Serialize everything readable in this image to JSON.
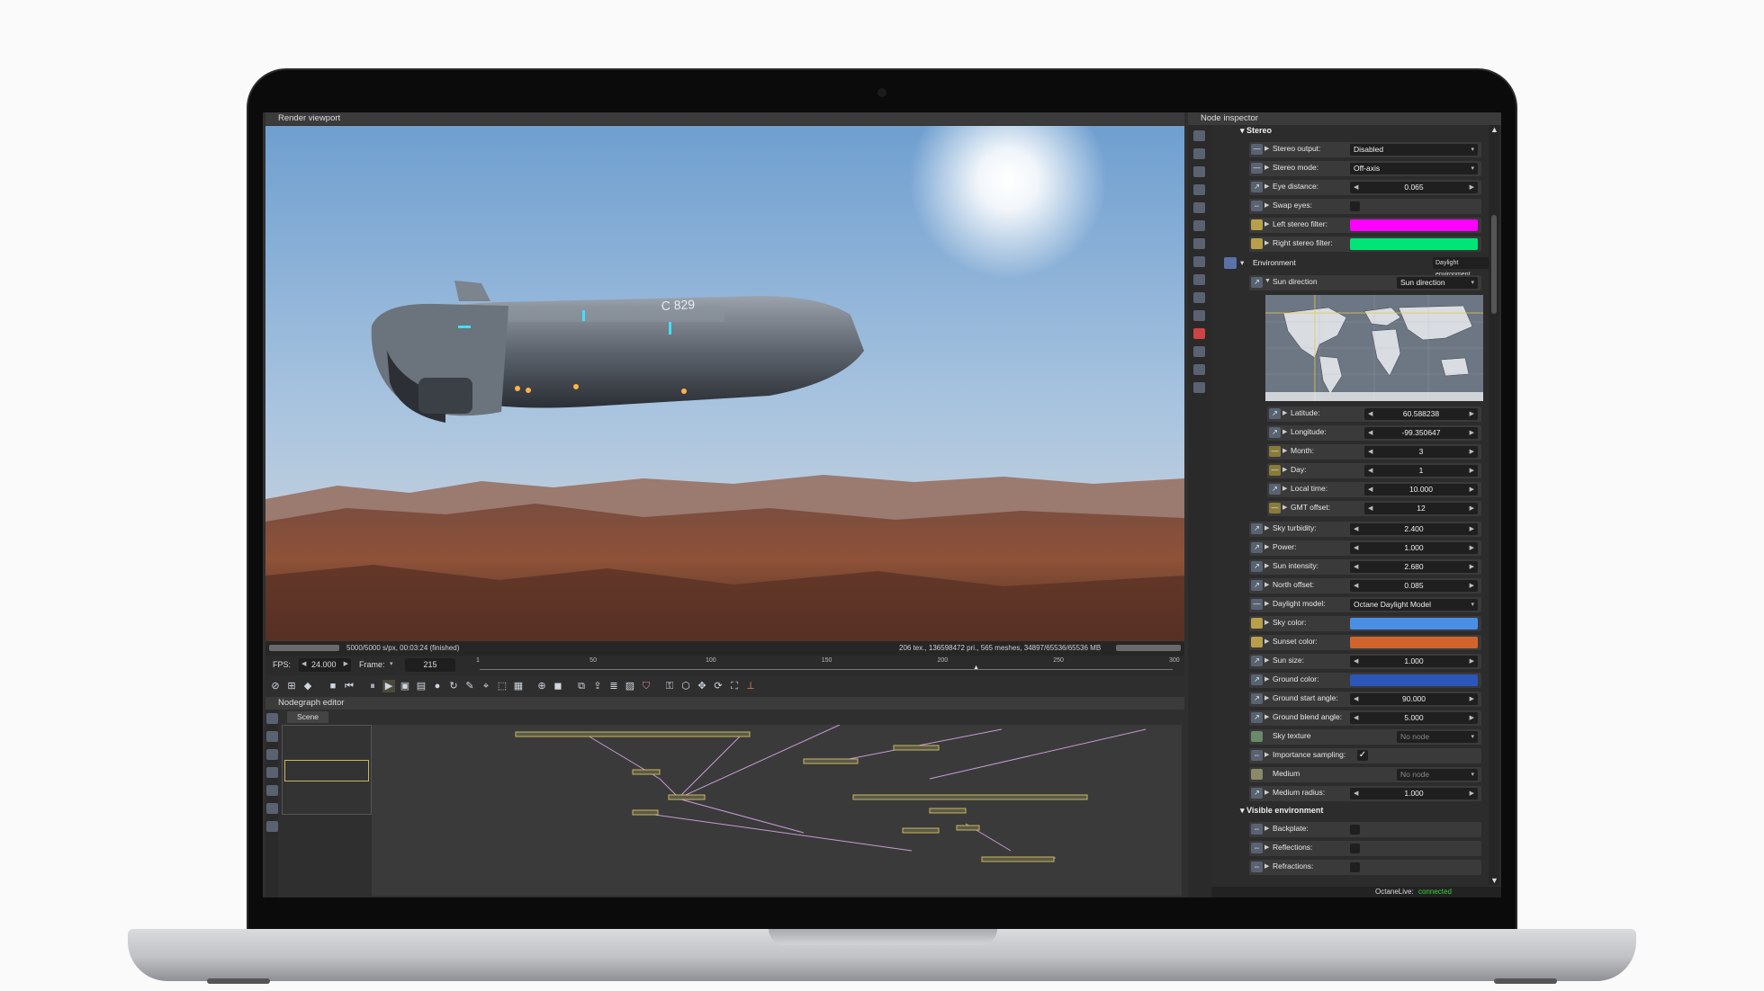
{
  "viewport": {
    "title": "Render viewport",
    "status_left": "5000/5000 s/px, 00:03:24 (finished)",
    "status_right": "206 tex., 136598472 pri., 565 meshes, 34897/65536/65536 MB"
  },
  "timeline": {
    "fps_label": "FPS:",
    "fps_value": "24.000",
    "frame_label": "Frame:",
    "frame_value": "215",
    "ticks": [
      "1",
      "50",
      "100",
      "150",
      "200",
      "250",
      "300"
    ],
    "playhead_frame": 215
  },
  "nodegraph": {
    "title": "Nodegraph editor",
    "tab": "Scene"
  },
  "inspector": {
    "title": "Node inspector",
    "stereo": {
      "header": "Stereo",
      "stereo_output": {
        "label": "Stereo output:",
        "value": "Disabled"
      },
      "stereo_mode": {
        "label": "Stereo mode:",
        "value": "Off-axis"
      },
      "eye_distance": {
        "label": "Eye distance:",
        "value": "0.065"
      },
      "swap_eyes": {
        "label": "Swap eyes:"
      },
      "left_filter": {
        "label": "Left stereo filter:",
        "color": "#ff00ff"
      },
      "right_filter": {
        "label": "Right stereo filter:",
        "color": "#00e676"
      }
    },
    "environment": {
      "header": "Environment",
      "type": "Daylight environment",
      "sun_direction": {
        "label": "Sun direction",
        "value": "Sun direction"
      },
      "latitude": {
        "label": "Latitude:",
        "value": "60.588238"
      },
      "longitude": {
        "label": "Longitude:",
        "value": "-99.350647"
      },
      "month": {
        "label": "Month:",
        "value": "3"
      },
      "day": {
        "label": "Day:",
        "value": "1"
      },
      "local_time": {
        "label": "Local time:",
        "value": "10.000"
      },
      "gmt_offset": {
        "label": "GMT offset:",
        "value": "12"
      },
      "sky_turbidity": {
        "label": "Sky turbidity:",
        "value": "2.400"
      },
      "power": {
        "label": "Power:",
        "value": "1.000"
      },
      "sun_intensity": {
        "label": "Sun intensity:",
        "value": "2.680"
      },
      "north_offset": {
        "label": "North offset:",
        "value": "0.085"
      },
      "daylight_model": {
        "label": "Daylight model:",
        "value": "Octane Daylight Model"
      },
      "sky_color": {
        "label": "Sky color:",
        "color": "#4a8fe6"
      },
      "sunset_color": {
        "label": "Sunset color:",
        "color": "#d2642b"
      },
      "sun_size": {
        "label": "Sun size:",
        "value": "1.000"
      },
      "ground_color": {
        "label": "Ground color:",
        "color": "#2c56b8"
      },
      "ground_start_angle": {
        "label": "Ground start angle:",
        "value": "90.000"
      },
      "ground_blend_angle": {
        "label": "Ground blend angle:",
        "value": "5.000"
      },
      "sky_texture": {
        "label": "Sky texture",
        "value": "No node"
      },
      "importance_sampling": {
        "label": "Importance sampling:"
      },
      "medium": {
        "label": "Medium",
        "value": "No node"
      },
      "medium_radius": {
        "label": "Medium radius:",
        "value": "1.000"
      }
    },
    "visible_environment": {
      "header": "Visible environment",
      "backplate": {
        "label": "Backplate:"
      },
      "reflections": {
        "label": "Reflections:"
      },
      "refractions": {
        "label": "Refractions:"
      }
    },
    "footer_label": "OctaneLive:",
    "footer_status": "connected",
    "footer_status_color": "#3ad13a"
  },
  "ship_marking": "C 829"
}
